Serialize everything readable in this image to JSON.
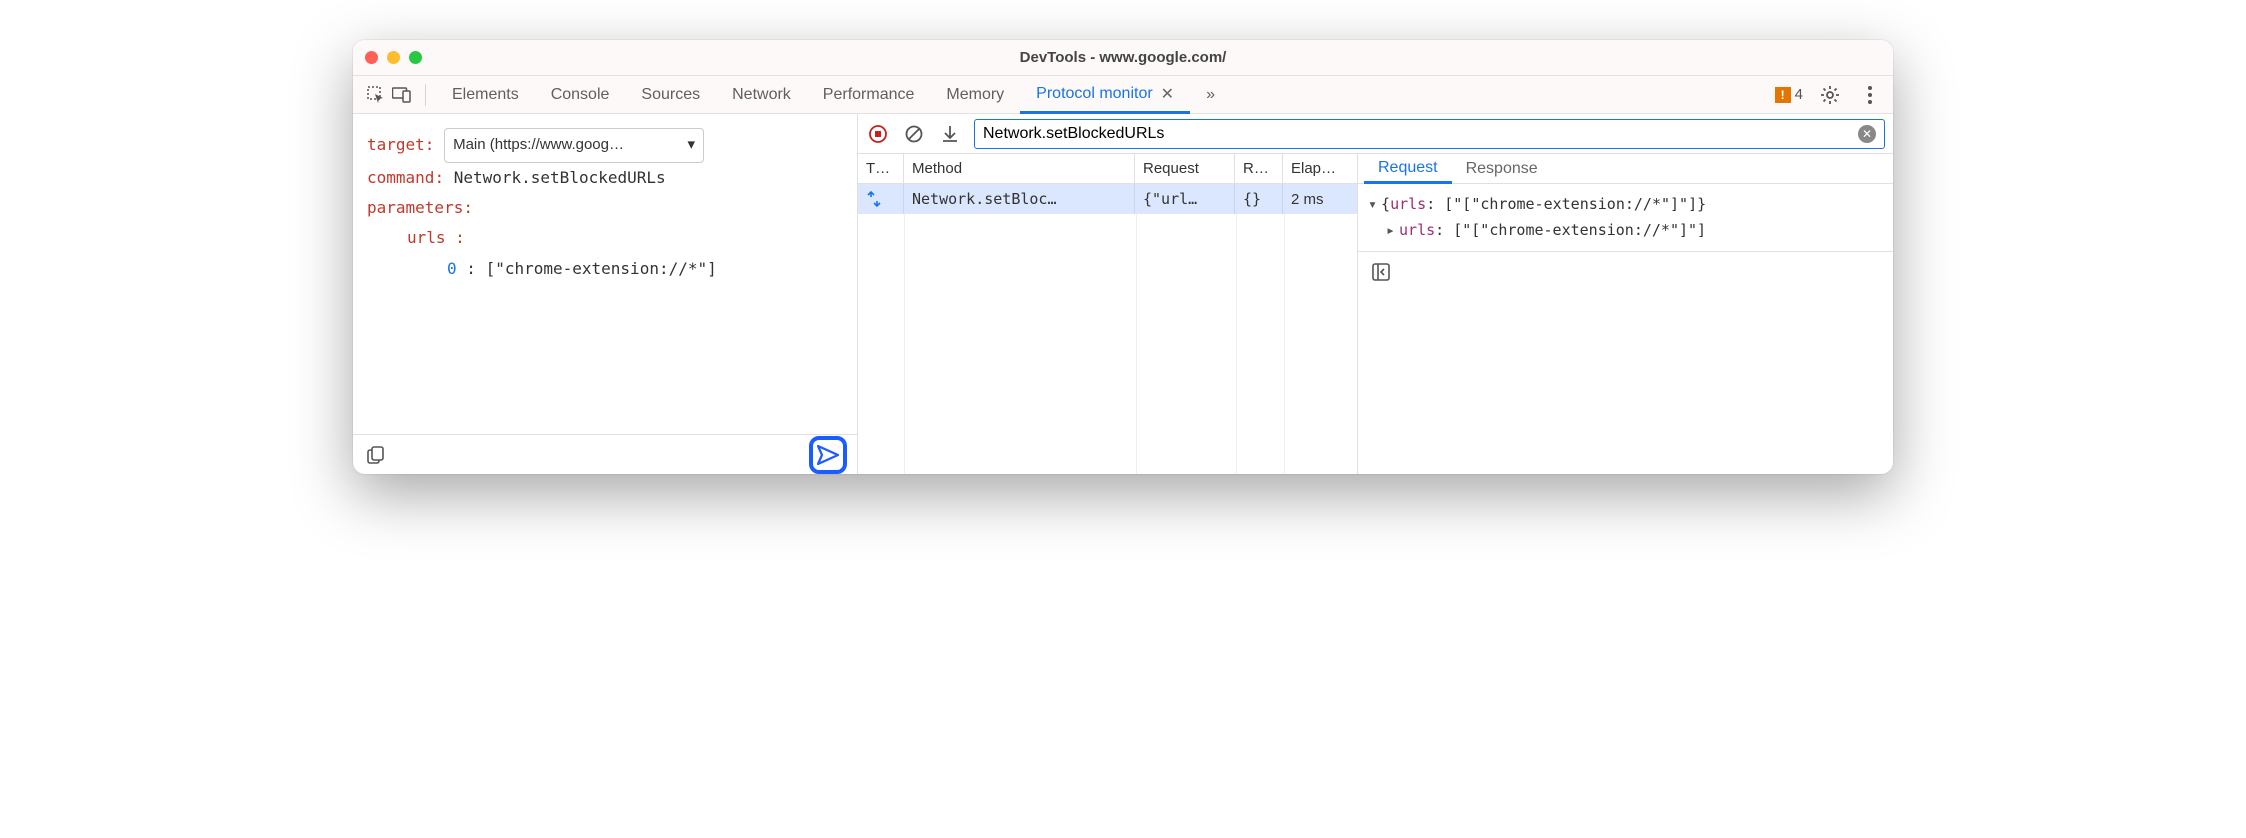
{
  "window_title": "DevTools - www.google.com/",
  "toolbar": {
    "tabs": [
      "Elements",
      "Console",
      "Sources",
      "Network",
      "Performance",
      "Memory"
    ],
    "active_tab": "Protocol monitor",
    "warn_count": "4"
  },
  "editor": {
    "target_label": "target",
    "target_value": "Main (https://www.goog…",
    "command_label": "command",
    "command_value": "Network.setBlockedURLs",
    "parameters_label": "parameters",
    "param_key": "urls",
    "item_index": "0",
    "item_value": "[\"chrome-extension://*\"]"
  },
  "filter": {
    "search_value": "Network.setBlockedURLs"
  },
  "grid": {
    "headers": {
      "type": "T…",
      "method": "Method",
      "request": "Request",
      "response": "R…",
      "elapsed": "Elap…"
    },
    "row": {
      "method": "Network.setBloc…",
      "request": "{\"url…",
      "response": "{}",
      "elapsed": "2 ms"
    }
  },
  "detail": {
    "tabs": {
      "request": "Request",
      "response": "Response"
    },
    "root_key": "urls",
    "root_preview": "[\"[\"chrome-extension://*\"]\"]",
    "child_key": "urls",
    "child_value": "[\"[\"chrome-extension://*\"]\"]"
  }
}
